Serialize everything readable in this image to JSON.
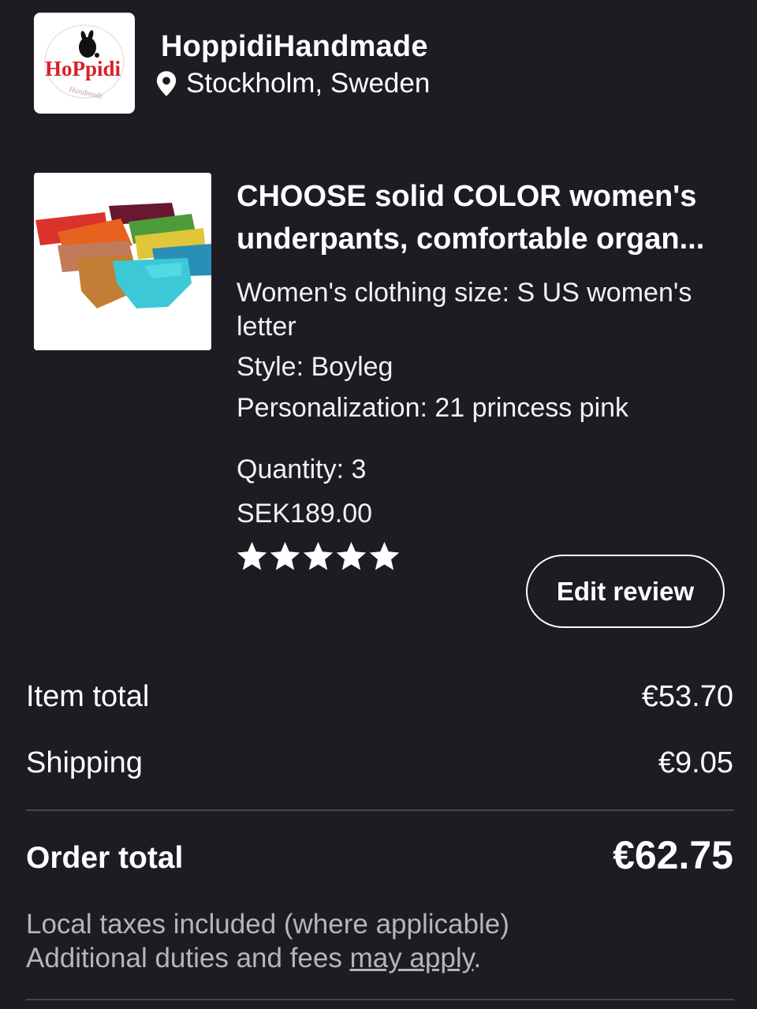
{
  "shop": {
    "logo_text": "HoPpidi",
    "logo_subtext": "Handmade",
    "name": "HoppidiHandmade",
    "location": "Stockholm, Sweden",
    "icon": "location-pin-icon"
  },
  "product": {
    "title_line1": "CHOOSE solid COLOR women's",
    "title_line2": "underpants, comfortable organ...",
    "size_line1": "Women's clothing size: S US women's",
    "size_line2": "letter",
    "style": "Style: Boyleg",
    "personalization": "Personalization: 21 princess pink",
    "quantity": "Quantity: 3",
    "price": "SEK189.00",
    "rating": 5,
    "rating_max": 5,
    "edit_review_label": "Edit review"
  },
  "summary": {
    "item_total_label": "Item total",
    "item_total_value": "€53.70",
    "shipping_label": "Shipping",
    "shipping_value": "€9.05",
    "order_total_label": "Order total",
    "order_total_value": "€62.75",
    "tax_note": "Local taxes included (where applicable)",
    "duties_prefix": "Additional duties and fees ",
    "duties_link": "may apply",
    "duties_suffix": "."
  },
  "colors": {
    "background": "#1e1b22",
    "text": "#ffffff",
    "muted_text": "#b7b4bb",
    "logo_red": "#d8202a"
  }
}
